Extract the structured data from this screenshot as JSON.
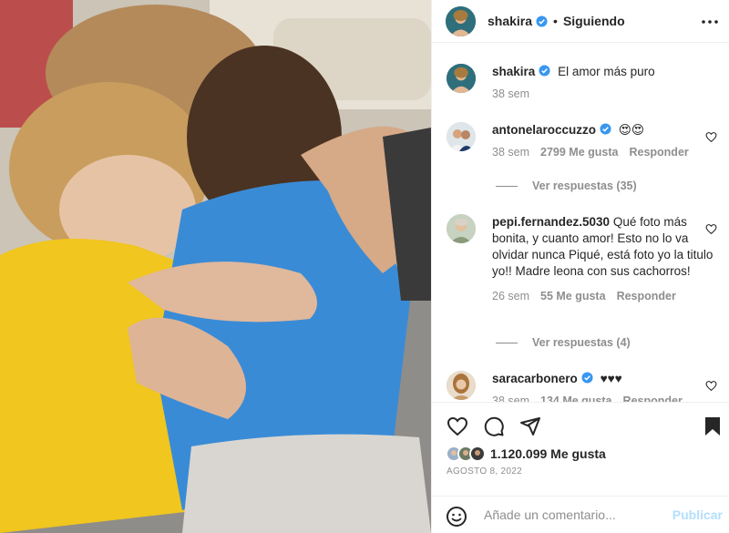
{
  "post": {
    "username": "shakira",
    "follow_status": "Siguiendo",
    "separator": "•",
    "caption": "El amor más puro",
    "caption_time": "38 sem"
  },
  "comments": [
    {
      "username": "antonelaroccuzzo",
      "text": "😍😍",
      "time": "38 sem",
      "likes": "2799 Me gusta",
      "reply": "Responder",
      "view_replies": "Ver respuestas (35)"
    },
    {
      "username": "pepi.fernandez.5030",
      "text": "Qué foto más bonita, y cuanto amor! Esto no lo va olvidar nunca Piqué, está foto yo la titulo yo!! Madre leona con sus cachorros!",
      "time": "26 sem",
      "likes": "55 Me gusta",
      "reply": "Responder",
      "view_replies": "Ver respuestas (4)"
    },
    {
      "username": "saracarbonero",
      "text": "♥♥♥",
      "time": "38 sem",
      "likes": "134 Me gusta",
      "reply": "Responder"
    }
  ],
  "footer": {
    "likes_count": "1.120.099 Me gusta",
    "date": "AGOSTO 8, 2022",
    "comment_placeholder": "Añade un comentario...",
    "publish_label": "Publicar"
  },
  "icons": {
    "verified": "verified-badge-icon",
    "more": "more-options-icon",
    "like": "heart-icon",
    "comment": "comment-icon",
    "share": "share-icon",
    "save": "bookmark-icon",
    "emoji": "emoji-icon"
  },
  "colors": {
    "verified_blue": "#3897f0",
    "secondary_text": "#8e8e8e",
    "publish_disabled": "#b2dffc"
  }
}
